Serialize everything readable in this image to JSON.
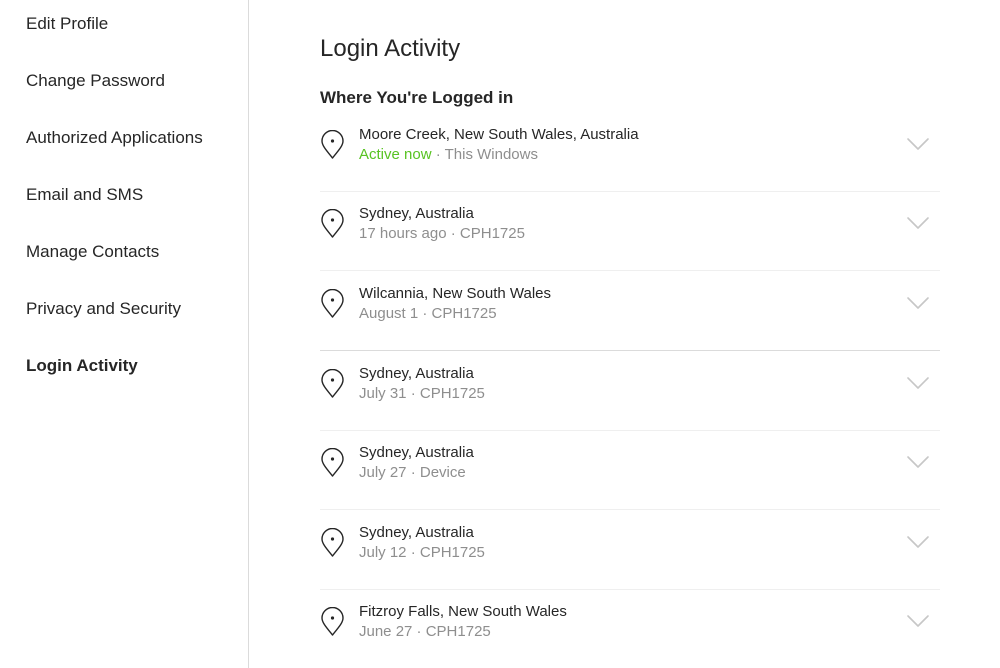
{
  "sidebar": {
    "items": [
      {
        "label": "Edit Profile"
      },
      {
        "label": "Change Password"
      },
      {
        "label": "Authorized Applications"
      },
      {
        "label": "Email and SMS"
      },
      {
        "label": "Manage Contacts"
      },
      {
        "label": "Privacy and Security"
      },
      {
        "label": "Login Activity"
      }
    ],
    "active_item": "Login Activity"
  },
  "main": {
    "title": "Login Activity",
    "section_title": "Where You're Logged in",
    "sessions": [
      {
        "location": "Moore Creek, New South Wales, Australia",
        "status": "Active now",
        "detail": " · This Windows",
        "icon": "map-pin-icon"
      },
      {
        "location": "Sydney, Australia",
        "when": "17 hours ago · CPH1725",
        "icon": "map-pin-icon"
      },
      {
        "location": "Wilcannia, New South Wales",
        "when": "August 1 · CPH1725",
        "icon": "map-pin-icon"
      },
      {
        "location": "Sydney, Australia",
        "when": "July 31 · CPH1725",
        "icon": "map-pin-icon"
      },
      {
        "location": "Sydney, Australia",
        "when": "July 27 · Device",
        "icon": "map-pin-icon"
      },
      {
        "location": "Sydney, Australia",
        "when": "July 12 · CPH1725",
        "icon": "map-pin-icon"
      },
      {
        "location": "Fitzroy Falls, New South Wales",
        "when": "June 27 · CPH1725",
        "icon": "map-pin-icon"
      }
    ]
  },
  "colors": {
    "text": "#262626",
    "muted": "#8e8e8e",
    "active": "#58c322",
    "divider": "#efefef",
    "border": "#dbdbdb"
  }
}
